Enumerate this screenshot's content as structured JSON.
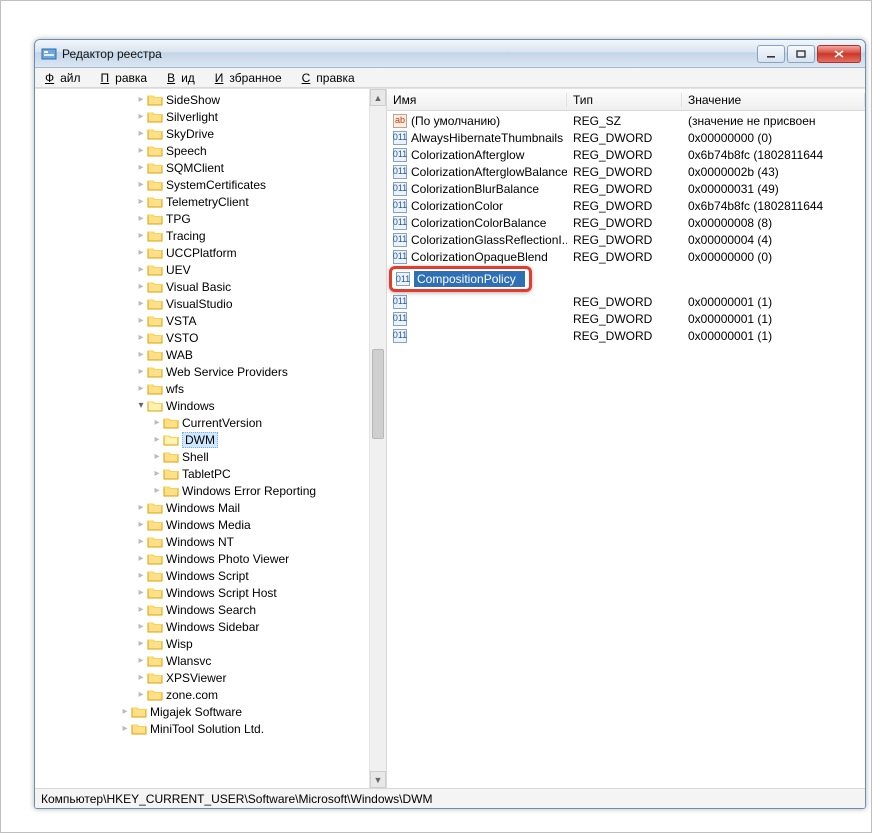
{
  "title": "Редактор реестра",
  "menu": {
    "file": "Файл",
    "edit": "Правка",
    "view": "Вид",
    "favorites": "Избранное",
    "help": "Справка"
  },
  "columns": {
    "name": "Имя",
    "type": "Тип",
    "value": "Значение"
  },
  "tree": [
    {
      "d": 6,
      "t": "",
      "label": "SideShow"
    },
    {
      "d": 6,
      "t": "",
      "label": "Silverlight"
    },
    {
      "d": 6,
      "t": "",
      "label": "SkyDrive"
    },
    {
      "d": 6,
      "t": "",
      "label": "Speech"
    },
    {
      "d": 6,
      "t": "",
      "label": "SQMClient"
    },
    {
      "d": 6,
      "t": "",
      "label": "SystemCertificates"
    },
    {
      "d": 6,
      "t": "",
      "label": "TelemetryClient"
    },
    {
      "d": 6,
      "t": "",
      "label": "TPG"
    },
    {
      "d": 6,
      "t": "",
      "label": "Tracing"
    },
    {
      "d": 6,
      "t": "",
      "label": "UCCPlatform"
    },
    {
      "d": 6,
      "t": "",
      "label": "UEV"
    },
    {
      "d": 6,
      "t": "",
      "label": "Visual Basic"
    },
    {
      "d": 6,
      "t": "",
      "label": "VisualStudio"
    },
    {
      "d": 6,
      "t": "",
      "label": "VSTA"
    },
    {
      "d": 6,
      "t": "",
      "label": "VSTO"
    },
    {
      "d": 6,
      "t": "",
      "label": "WAB"
    },
    {
      "d": 6,
      "t": "",
      "label": "Web Service Providers"
    },
    {
      "d": 6,
      "t": "",
      "label": "wfs"
    },
    {
      "d": 6,
      "t": "▾",
      "label": "Windows",
      "open": true
    },
    {
      "d": 7,
      "t": "",
      "label": "CurrentVersion"
    },
    {
      "d": 7,
      "t": "",
      "label": "DWM",
      "sel": true
    },
    {
      "d": 7,
      "t": "",
      "label": "Shell"
    },
    {
      "d": 7,
      "t": "",
      "label": "TabletPC"
    },
    {
      "d": 7,
      "t": "",
      "label": "Windows Error Reporting"
    },
    {
      "d": 6,
      "t": "",
      "label": "Windows Mail"
    },
    {
      "d": 6,
      "t": "",
      "label": "Windows Media"
    },
    {
      "d": 6,
      "t": "",
      "label": "Windows NT"
    },
    {
      "d": 6,
      "t": "",
      "label": "Windows Photo Viewer"
    },
    {
      "d": 6,
      "t": "",
      "label": "Windows Script"
    },
    {
      "d": 6,
      "t": "",
      "label": "Windows Script Host"
    },
    {
      "d": 6,
      "t": "",
      "label": "Windows Search"
    },
    {
      "d": 6,
      "t": "",
      "label": "Windows Sidebar"
    },
    {
      "d": 6,
      "t": "",
      "label": "Wisp"
    },
    {
      "d": 6,
      "t": "",
      "label": "Wlansvc"
    },
    {
      "d": 6,
      "t": "",
      "label": "XPSViewer"
    },
    {
      "d": 6,
      "t": "",
      "label": "zone.com"
    },
    {
      "d": 5,
      "t": "",
      "label": "Migajek Software"
    },
    {
      "d": 5,
      "t": "",
      "label": "MiniTool Solution Ltd."
    }
  ],
  "values": [
    {
      "icon": "str",
      "name": "(По умолчанию)",
      "type": "REG_SZ",
      "value": "(значение не присвоен"
    },
    {
      "icon": "dw",
      "name": "AlwaysHibernateThumbnails",
      "type": "REG_DWORD",
      "value": "0x00000000 (0)"
    },
    {
      "icon": "dw",
      "name": "ColorizationAfterglow",
      "type": "REG_DWORD",
      "value": "0x6b74b8fc (1802811644"
    },
    {
      "icon": "dw",
      "name": "ColorizationAfterglowBalance",
      "type": "REG_DWORD",
      "value": "0x0000002b (43)"
    },
    {
      "icon": "dw",
      "name": "ColorizationBlurBalance",
      "type": "REG_DWORD",
      "value": "0x00000031 (49)"
    },
    {
      "icon": "dw",
      "name": "ColorizationColor",
      "type": "REG_DWORD",
      "value": "0x6b74b8fc (1802811644"
    },
    {
      "icon": "dw",
      "name": "ColorizationColorBalance",
      "type": "REG_DWORD",
      "value": "0x00000008 (8)"
    },
    {
      "icon": "dw",
      "name": "ColorizationGlassReflectionI...",
      "type": "REG_DWORD",
      "value": "0x00000004 (4)"
    },
    {
      "icon": "dw",
      "name": "ColorizationOpaqueBlend",
      "type": "REG_DWORD",
      "value": "0x00000000 (0)"
    }
  ],
  "values_after": [
    {
      "icon": "dw",
      "name": "",
      "type": "REG_DWORD",
      "value": "0x00000001 (1)"
    },
    {
      "icon": "dw",
      "name": "",
      "type": "REG_DWORD",
      "value": "0x00000001 (1)"
    },
    {
      "icon": "dw",
      "name": "",
      "type": "REG_DWORD",
      "value": "0x00000001 (1)"
    }
  ],
  "editing_name": "CompositionPolicy",
  "status_path": "Компьютер\\HKEY_CURRENT_USER\\Software\\Microsoft\\Windows\\DWM"
}
